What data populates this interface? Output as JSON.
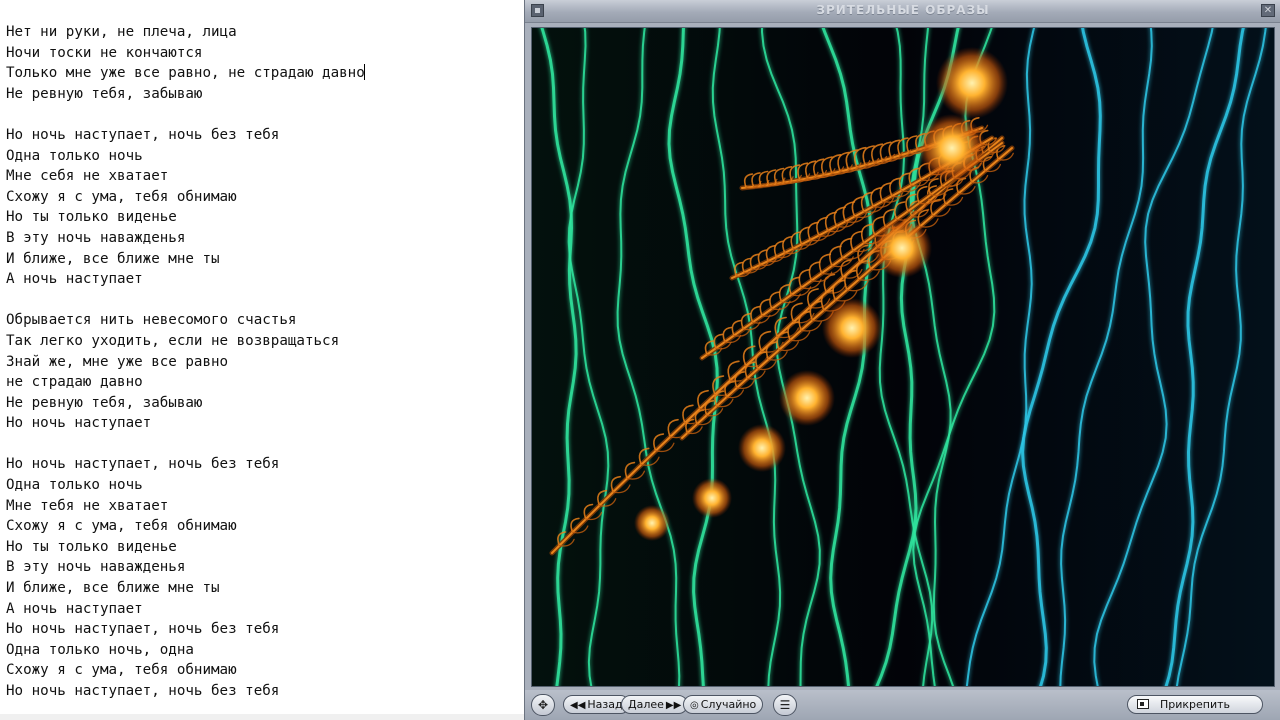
{
  "editor": {
    "lines": [
      "Нет ни руки, не плеча, лица",
      "Ночи тоски не кончаются",
      "Только мне уже все равно, не страдаю давно",
      "Не ревную тебя, забываю",
      "",
      "Но ночь наступает, ночь без тебя",
      "Одна только ночь",
      "Мне себя не хватает",
      "Схожу я с ума, тебя обнимаю",
      "Но ты только виденье",
      "В эту ночь наважденья",
      "И ближе, все ближе мне ты",
      "А ночь наступает",
      "",
      "Обрывается нить невесомого счастья",
      "Так легко уходить, если не возвращаться",
      "Знай же, мне уже все равно",
      "не страдаю давно",
      "Не ревную тебя, забываю",
      "Но ночь наступает",
      "",
      "Но ночь наступает, ночь без тебя",
      "Одна только ночь",
      "Мне тебя не хватает",
      "Схожу я с ума, тебя обнимаю",
      "Но ты только виденье",
      "В эту ночь наважденья",
      "И ближе, все ближе мне ты",
      "А ночь наступает",
      "Но ночь наступает, ночь без тебя",
      "Одна только ночь, одна",
      "Схожу я с ума, тебя обнимаю",
      "Но ночь наступает, ночь без тебя"
    ]
  },
  "visualizer": {
    "title": "ЗРИТЕЛЬНЫЕ ОБРАЗЫ",
    "controls": {
      "back_label": "Назад",
      "next_label": "Далее",
      "random_label": "Случайно",
      "dock_label": "Прикрепить"
    },
    "colors": {
      "chrome": "#a9b0bc",
      "canvas_bg": "#020308",
      "line_green": "#2fe7a0",
      "line_cyan": "#2ec8e8",
      "fern_orange": "#f08a1c"
    }
  }
}
